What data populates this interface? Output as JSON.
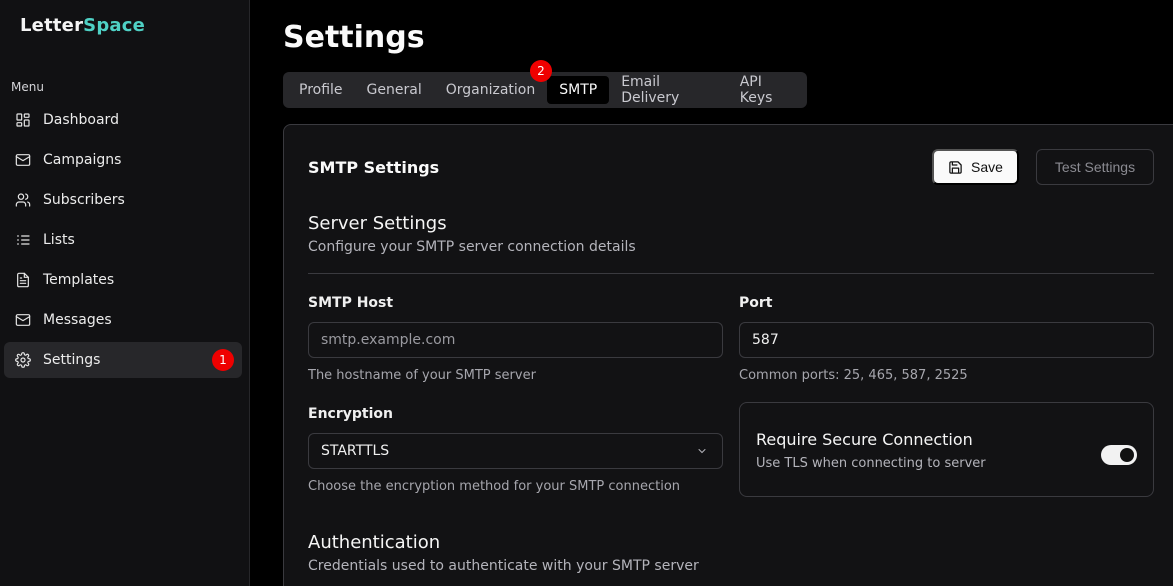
{
  "brand": {
    "part1": "Letter",
    "part2": "Space",
    "accent_color": "#4fd1c5"
  },
  "sidebar": {
    "menu_label": "Menu",
    "items": [
      {
        "label": "Dashboard",
        "icon": "dashboard-icon"
      },
      {
        "label": "Campaigns",
        "icon": "mail-icon"
      },
      {
        "label": "Subscribers",
        "icon": "users-icon"
      },
      {
        "label": "Lists",
        "icon": "list-icon"
      },
      {
        "label": "Templates",
        "icon": "file-icon"
      },
      {
        "label": "Messages",
        "icon": "mail-icon"
      },
      {
        "label": "Settings",
        "icon": "gear-icon",
        "active": true,
        "badge": "1"
      }
    ]
  },
  "page": {
    "title": "Settings"
  },
  "tabs": {
    "items": [
      "Profile",
      "General",
      "Organization",
      "SMTP",
      "Email Delivery",
      "API Keys"
    ],
    "active": "SMTP",
    "badge": "2"
  },
  "card": {
    "title": "SMTP Settings",
    "save_label": "Save",
    "test_label": "Test Settings"
  },
  "server": {
    "title": "Server Settings",
    "description": "Configure your SMTP server connection details",
    "host_label": "SMTP Host",
    "host_placeholder": "smtp.example.com",
    "host_value": "",
    "host_help": "The hostname of your SMTP server",
    "port_label": "Port",
    "port_value": "587",
    "port_help": "Common ports: 25, 465, 587, 2525",
    "encryption_label": "Encryption",
    "encryption_value": "STARTTLS",
    "encryption_help": "Choose the encryption method for your SMTP connection",
    "secure_title": "Require Secure Connection",
    "secure_desc": "Use TLS when connecting to server",
    "secure_enabled": true
  },
  "auth": {
    "title": "Authentication",
    "description": "Credentials used to authenticate with your SMTP server"
  },
  "colors": {
    "badge": "#ef0000",
    "background": "#000000",
    "card": "#121214"
  }
}
